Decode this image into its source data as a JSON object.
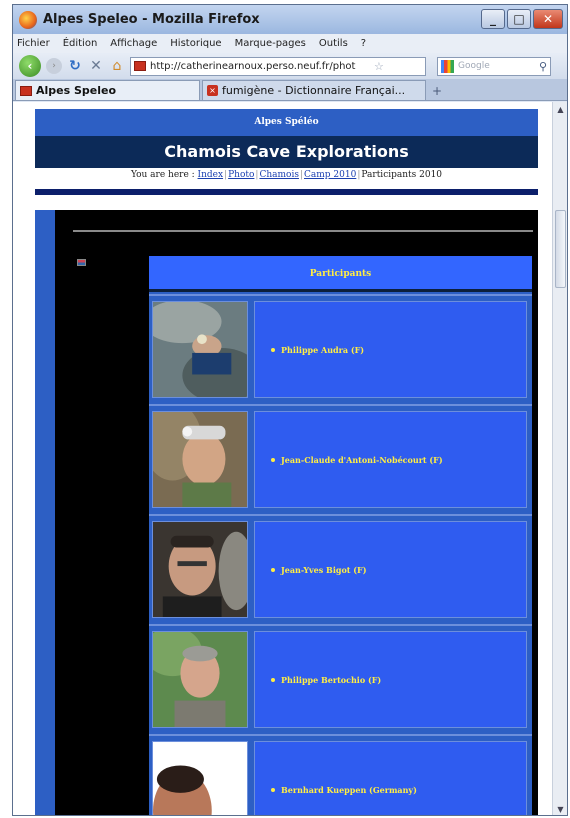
{
  "window": {
    "title": "Alpes Speleo - Mozilla Firefox"
  },
  "menu": [
    "Fichier",
    "Édition",
    "Affichage",
    "Historique",
    "Marque-pages",
    "Outils",
    "?"
  ],
  "nav": {
    "url": "http://catherinearnoux.perso.neuf.fr/phot",
    "search_placeholder": "Google"
  },
  "tabs": [
    {
      "label": "Alpes Speleo"
    },
    {
      "label": "fumigène - Dictionnaire Françai..."
    }
  ],
  "site": {
    "top_title": "Alpes Spéléo",
    "header": "Chamois Cave Explorations",
    "breadcrumb": {
      "prefix": "You are here : ",
      "links": [
        "Index",
        "Photo",
        "Chamois",
        "Camp 2010"
      ],
      "current": "Participants 2010"
    }
  },
  "table": {
    "header": "Participants",
    "participants": [
      {
        "name": "Philippe Audra (F)"
      },
      {
        "name": "Jean-Claude d'Antoni-Nobécourt (F)"
      },
      {
        "name": "Jean-Yves Bigot (F)"
      },
      {
        "name": "Philippe Bertochio (F)"
      },
      {
        "name": "Bernhard Kueppen (Germany)"
      }
    ]
  },
  "colors": {
    "site_blue": "#2d5fc4",
    "header_navy": "#0c2a58",
    "name_yellow": "#ffee44",
    "cell_blue": "#2f5cf0"
  }
}
